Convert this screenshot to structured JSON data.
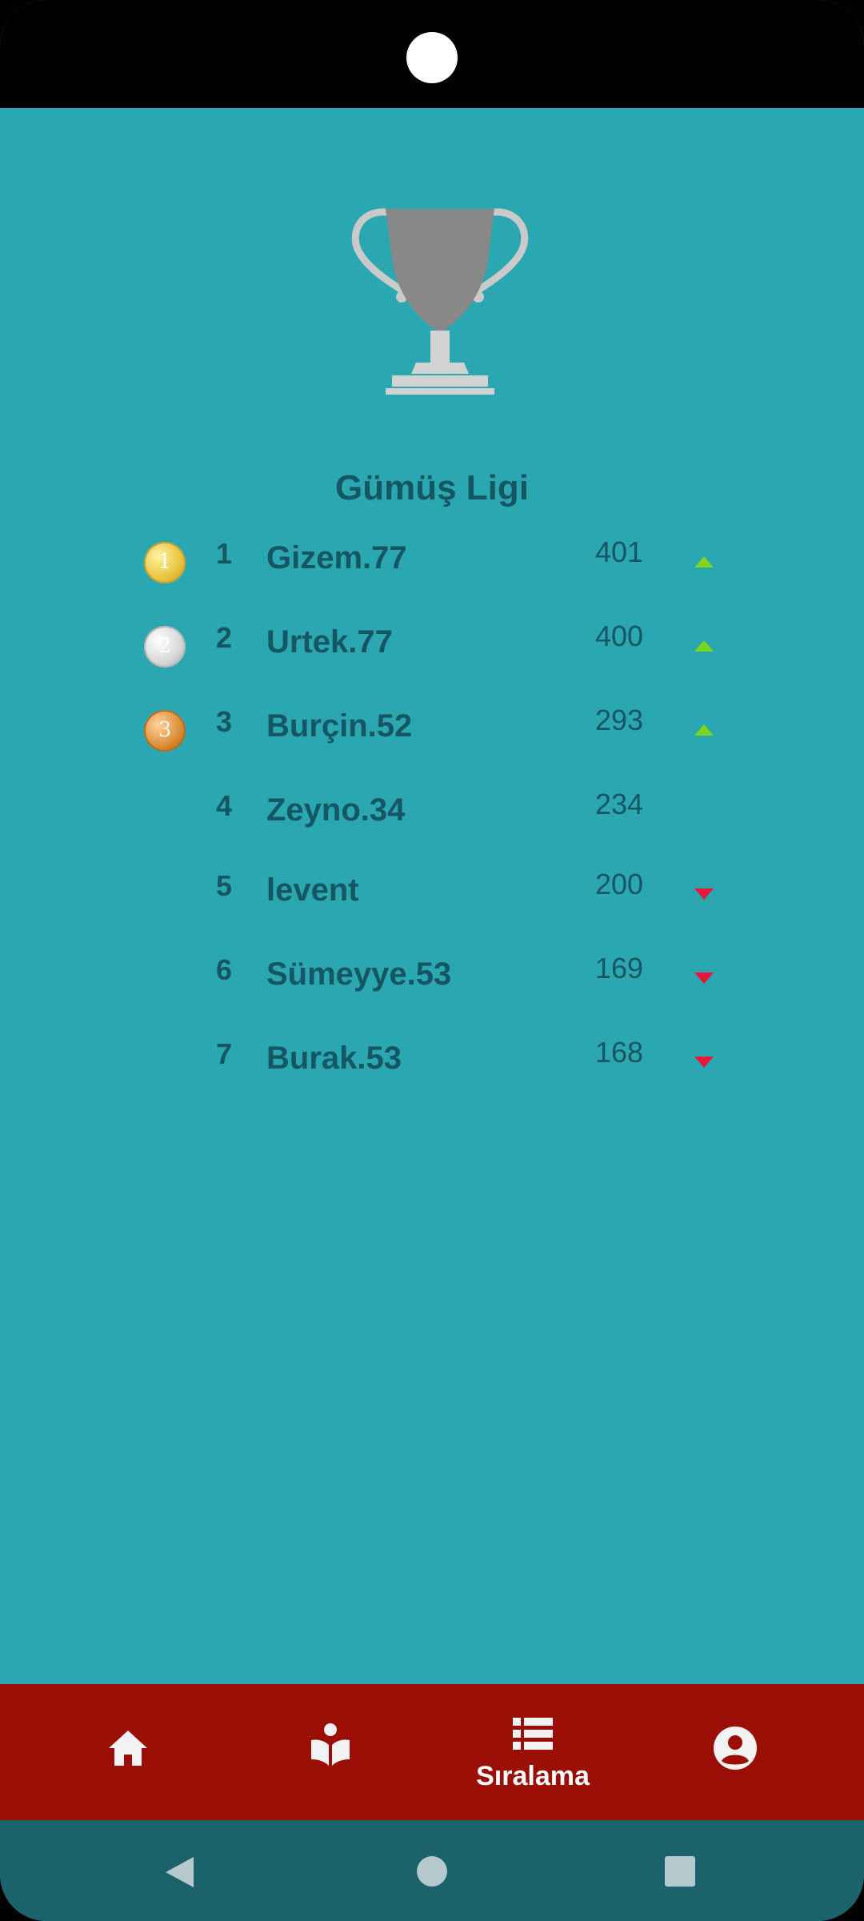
{
  "league": {
    "title": "Gümüş Ligi"
  },
  "leaderboard": [
    {
      "rank": "1",
      "name": "Gizem.77",
      "score": "401",
      "medal": "gold",
      "medal_digit": "1",
      "trend": "up"
    },
    {
      "rank": "2",
      "name": "Urtek.77",
      "score": "400",
      "medal": "silver",
      "medal_digit": "2",
      "trend": "up"
    },
    {
      "rank": "3",
      "name": "Burçin.52",
      "score": "293",
      "medal": "bronze",
      "medal_digit": "3",
      "trend": "up"
    },
    {
      "rank": "4",
      "name": "Zeyno.34",
      "score": "234",
      "medal": "",
      "trend": ""
    },
    {
      "rank": "5",
      "name": "levent",
      "score": "200",
      "medal": "",
      "trend": "down"
    },
    {
      "rank": "6",
      "name": "Sümeyye.53",
      "score": "169",
      "medal": "",
      "trend": "down"
    },
    {
      "rank": "7",
      "name": "Burak.53",
      "score": "168",
      "medal": "",
      "trend": "down"
    }
  ],
  "bottom_nav": {
    "items": [
      {
        "icon": "home-icon",
        "label": ""
      },
      {
        "icon": "book-reader-icon",
        "label": ""
      },
      {
        "icon": "list-icon",
        "label": "Sıralama",
        "active": true
      },
      {
        "icon": "account-circle-icon",
        "label": ""
      }
    ]
  },
  "colors": {
    "background": "#2AA7B1",
    "text": "#145661",
    "bottom_nav": "#9B0E06",
    "system_nav": "#1B626B",
    "trend_up": "#7CD61F",
    "trend_down": "#E8173A"
  }
}
